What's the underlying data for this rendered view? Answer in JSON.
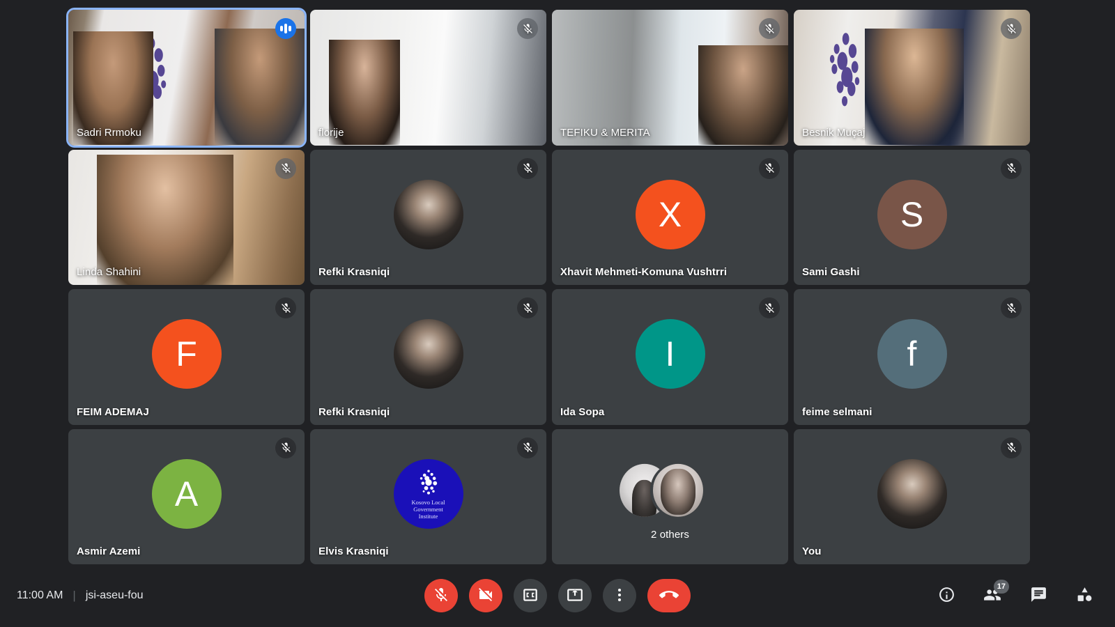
{
  "meeting": {
    "time": "11:00 AM",
    "separator": "|",
    "code": "jsi-aseu-fou"
  },
  "colors": {
    "accent_blue": "#1a73e8",
    "active_border": "#8ab4f8",
    "danger_red": "#ea4335",
    "tile_bg": "#3c4043",
    "page_bg": "#202124"
  },
  "tiles": [
    {
      "name": "Sadri Rrmoku",
      "kind": "video",
      "muted": false,
      "speaking": true,
      "active": true,
      "label_align": "left"
    },
    {
      "name": "florije",
      "kind": "video",
      "muted": true,
      "speaking": false,
      "active": false,
      "label_align": "left"
    },
    {
      "name": "TEFIKU & MERITA",
      "kind": "video",
      "muted": true,
      "speaking": false,
      "active": false,
      "label_align": "left"
    },
    {
      "name": "Besnik Muçaj",
      "kind": "video",
      "muted": true,
      "speaking": false,
      "active": false,
      "label_align": "left"
    },
    {
      "name": "Linda Shahini",
      "kind": "video",
      "muted": true,
      "speaking": false,
      "active": false,
      "label_align": "left"
    },
    {
      "name": "Refki Krasniqi",
      "kind": "photo",
      "muted": true,
      "speaking": false,
      "active": false,
      "label_align": "left"
    },
    {
      "name": "Xhavit Mehmeti-Komuna Vushtrri",
      "kind": "letter",
      "letter": "X",
      "avatar_color": "#f4511e",
      "muted": true,
      "speaking": false,
      "active": false,
      "label_align": "left"
    },
    {
      "name": "Sami Gashi",
      "kind": "letter",
      "letter": "S",
      "avatar_color": "#795548",
      "muted": true,
      "speaking": false,
      "active": false,
      "label_align": "left"
    },
    {
      "name": "FEIM ADEMAJ",
      "kind": "letter",
      "letter": "F",
      "avatar_color": "#f4511e",
      "muted": true,
      "speaking": false,
      "active": false,
      "label_align": "left"
    },
    {
      "name": "Refki Krasniqi",
      "kind": "photo",
      "muted": true,
      "speaking": false,
      "active": false,
      "label_align": "left"
    },
    {
      "name": "Ida Sopa",
      "kind": "letter",
      "letter": "I",
      "avatar_color": "#009688",
      "muted": true,
      "speaking": false,
      "active": false,
      "label_align": "left"
    },
    {
      "name": "feime selmani",
      "kind": "letter",
      "letter": "f",
      "avatar_color": "#546e7a",
      "muted": true,
      "speaking": false,
      "active": false,
      "label_align": "left"
    },
    {
      "name": "Asmir Azemi",
      "kind": "letter",
      "letter": "A",
      "avatar_color": "#7cb342",
      "muted": true,
      "speaking": false,
      "active": false,
      "label_align": "left"
    },
    {
      "name": "Elvis Krasniqi",
      "kind": "logo",
      "logo_text": [
        "Kosovo Local",
        "Government",
        "Institute"
      ],
      "muted": true,
      "speaking": false,
      "active": false,
      "label_align": "left"
    },
    {
      "name": "2 others",
      "kind": "duo",
      "muted": false,
      "speaking": false,
      "active": false,
      "label_align": "center"
    },
    {
      "name": "You",
      "kind": "photo",
      "muted": true,
      "speaking": false,
      "active": false,
      "label_align": "left"
    }
  ],
  "controls": {
    "mic": {
      "label": "Turn on microphone",
      "icon": "mic-off-icon",
      "state": "off"
    },
    "camera": {
      "label": "Turn on camera",
      "icon": "camera-off-icon",
      "state": "off"
    },
    "captions": {
      "label": "Turn on captions",
      "icon": "captions-icon",
      "state": "off"
    },
    "present": {
      "label": "Present now",
      "icon": "present-icon",
      "state": "off"
    },
    "more": {
      "label": "More options",
      "icon": "more-vert-icon"
    },
    "hangup": {
      "label": "Leave call",
      "icon": "call-end-icon"
    }
  },
  "right_controls": {
    "info": {
      "label": "Meeting details",
      "icon": "info-icon"
    },
    "people": {
      "label": "Show everyone",
      "icon": "people-icon",
      "count": "17"
    },
    "chat": {
      "label": "Chat with everyone",
      "icon": "chat-icon"
    },
    "activities": {
      "label": "Activities",
      "icon": "activities-icon"
    }
  }
}
